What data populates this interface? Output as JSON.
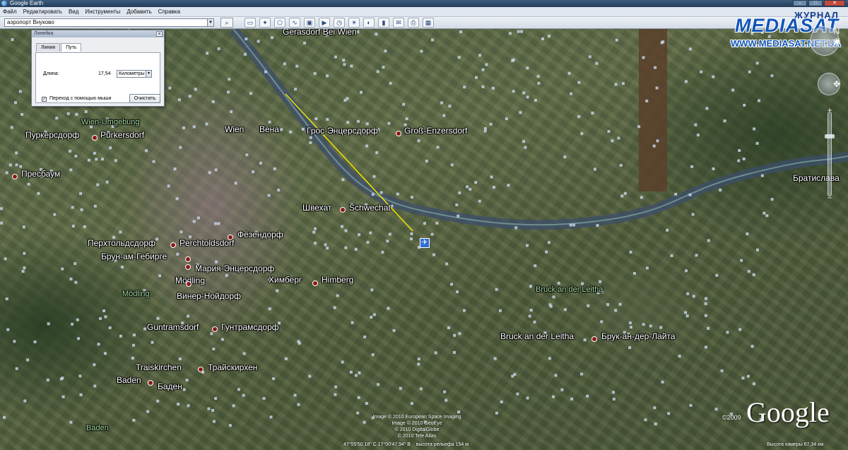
{
  "window": {
    "title": "Google Earth",
    "controls": [
      "–",
      "□",
      "✕"
    ]
  },
  "menu": [
    "Файл",
    "Редактировать",
    "Вид",
    "Инструменты",
    "Добавить",
    "Справка"
  ],
  "search": {
    "value": "аэропорт Внуково",
    "dropdown_icon": "chevron-down-icon",
    "button_icon": "search-icon"
  },
  "toolbar_icons": [
    "sidebar-icon",
    "placemark-icon",
    "polygon-icon",
    "path-icon",
    "image-overlay-icon",
    "tour-icon",
    "history-icon",
    "sun-icon",
    "planets-icon",
    "ruler-icon",
    "email-icon",
    "print-icon",
    "maps-icon"
  ],
  "ruler_dialog": {
    "title": "Линейка",
    "close": "×",
    "tabs": [
      "Линия",
      "Путь"
    ],
    "active_tab": "Путь",
    "length_label": "Длина:",
    "length_value": "17,54",
    "unit": "Километры",
    "mouse_nav_label": "Переход с помощью мыши",
    "mouse_nav_checked": true,
    "clear_button": "Очистить"
  },
  "watermark": {
    "journal": "ЖУРНАЛ",
    "brand": "MEDIASAT",
    "url": "WWW.MEDIASAT.NET.UA"
  },
  "places": [
    {
      "name": "Gerasdorf Bei Wien",
      "dot": false
    },
    {
      "name": "Wien-Umgebung",
      "dot": false,
      "region": true
    },
    {
      "name": "Пуркерсдорф",
      "dot": false
    },
    {
      "name": "Purkersdorf",
      "dot": true
    },
    {
      "name": "Wien",
      "dot": false
    },
    {
      "name": "Вена",
      "dot": false
    },
    {
      "name": "Грос-Энцерсдорф",
      "dot": false
    },
    {
      "name": "Groß-Enzersdorf",
      "dot": true
    },
    {
      "name": "Пресбаум",
      "dot": true
    },
    {
      "name": "Братислава",
      "dot": false
    },
    {
      "name": "Швехат",
      "dot": false
    },
    {
      "name": "Schwechat",
      "dot": true
    },
    {
      "name": "Фёзендорф",
      "dot": true
    },
    {
      "name": "Перхтольдсдорф",
      "dot": false
    },
    {
      "name": "Perchtoldsdorf",
      "dot": true
    },
    {
      "name": "Брун-ам-Гебирге",
      "dot": true
    },
    {
      "name": "Мария-Энцерсдорф",
      "dot": true
    },
    {
      "name": "Mödling",
      "dot": false
    },
    {
      "name": "Mödling",
      "dot": false,
      "region": true
    },
    {
      "name": "Химберг",
      "dot": false
    },
    {
      "name": "Himberg",
      "dot": true
    },
    {
      "name": "Винер-Нойдорф",
      "dot": false
    },
    {
      "name": "Bruck an der Leitha",
      "dot": false,
      "region": true
    },
    {
      "name": "Guntramsdorf",
      "dot": false
    },
    {
      "name": "Гунтрамсдорф",
      "dot": true
    },
    {
      "name": "Bruck an der Leitha",
      "dot": false
    },
    {
      "name": "Брук-ан-дер-Лайта",
      "dot": true
    },
    {
      "name": "Traiskirchen",
      "dot": false
    },
    {
      "name": "Трайскирхен",
      "dot": true
    },
    {
      "name": "Baden",
      "dot": false
    },
    {
      "name": "Баден",
      "dot": true
    },
    {
      "name": "Baden",
      "dot": false,
      "region": true
    }
  ],
  "imagery_credits": [
    "Image © 2010 European Space Imaging",
    "Image © 2010 GeoEye",
    "© 2010 DigitalGlobe",
    "© 2010 Tele Atlas"
  ],
  "google": {
    "year": "©2009",
    "logo": "Google"
  },
  "status": {
    "coords": "47°55'50.18\" С   17°00'47.94\" В",
    "elevation": "высота рельефа  154 м",
    "eye_altitude": "Высота камеры   67,34 км"
  },
  "ruler_path_color": "#f2e600"
}
